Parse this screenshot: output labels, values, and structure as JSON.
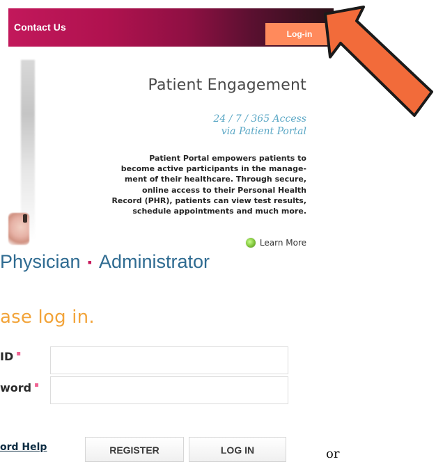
{
  "nav": {
    "contact_us": "Contact Us",
    "log_in": "Log-in"
  },
  "card": {
    "title": "Patient Engagement",
    "access_line_1": "24 / 7 / 365 Access",
    "access_line_2": "via Patient Portal",
    "body_lines": [
      "Patient Portal empowers patients to",
      "become active participants in the manage-",
      "ment of their healthcare. Through secure,",
      "online access to their Personal Health",
      "Record (PHR), patients can view test results,",
      "schedule appointments and much more."
    ],
    "learn_more": "Learn More"
  },
  "roles": {
    "physician": "Physician",
    "separator": "▪",
    "administrator": "Administrator"
  },
  "login": {
    "prompt": "ase log in.",
    "user_label": "ID",
    "password_label": "word",
    "required_marker": "▪",
    "user_value": "",
    "password_value": ""
  },
  "actions": {
    "password_help": "ord Help",
    "register": "REGISTER",
    "log_in": "LOG IN",
    "or": "or"
  },
  "colors": {
    "arrow_fill": "#f26b3a",
    "arrow_stroke": "#1a1a1a",
    "nav_login_bg": "#ff8a5c"
  },
  "icons": {
    "arrow": "arrow-icon",
    "learn_more": "learn-more-icon"
  }
}
